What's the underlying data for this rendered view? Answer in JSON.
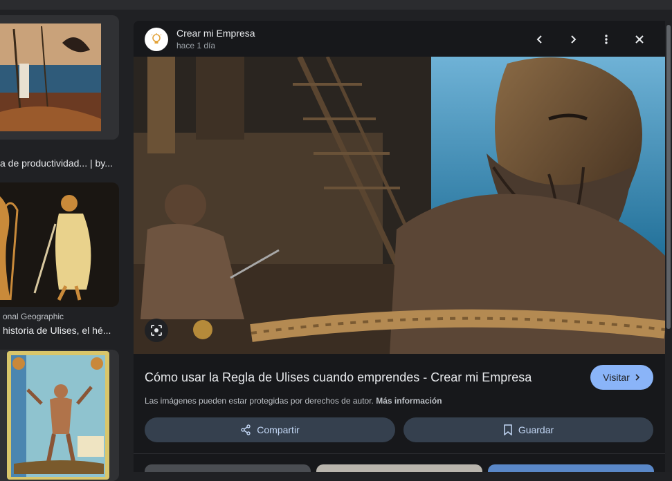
{
  "results": {
    "item1": {
      "title": "a de productividad... | by..."
    },
    "item2": {
      "source": "onal Geographic",
      "title": "historia de Ulises, el hé..."
    },
    "item3": {}
  },
  "preview": {
    "site_name": "Crear mi Empresa",
    "time": "hace 1 día",
    "title": "Cómo usar la Regla de Ulises cuando emprendes - Crear mi Empresa",
    "visit_label": "Visitar",
    "copyright_text": "Las imágenes pueden estar protegidas por derechos de autor.",
    "copyright_link": "Más información",
    "share_label": "Compartir",
    "save_label": "Guardar"
  },
  "icons": {
    "prev": "chevron-left-icon",
    "next": "chevron-right-icon",
    "more": "more-vert-icon",
    "close": "close-icon",
    "lens": "lens-icon",
    "share": "share-icon",
    "save": "bookmark-icon"
  },
  "colors": {
    "background": "#202124",
    "panel": "#17181b",
    "accent": "#8ab4f8",
    "action_button": "#35404e"
  }
}
